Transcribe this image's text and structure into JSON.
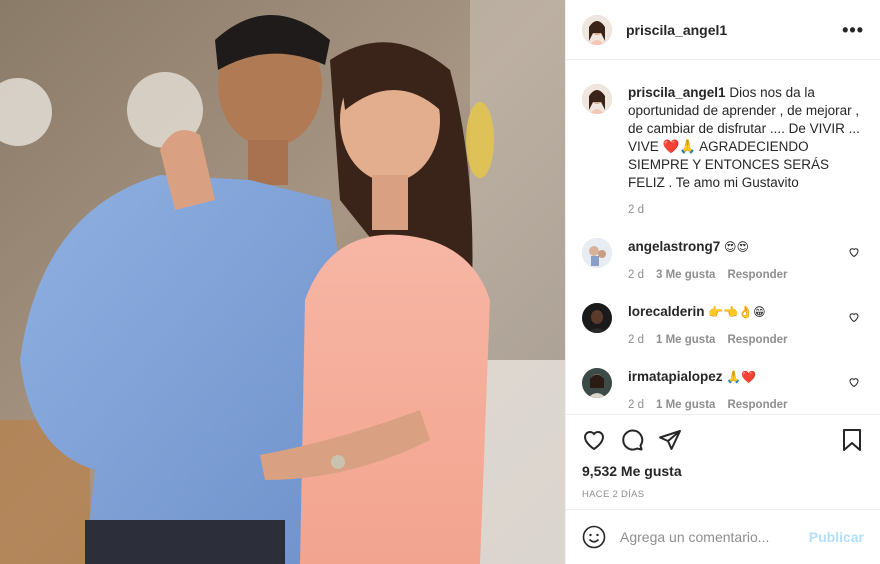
{
  "post": {
    "author": "priscila_angel1",
    "more_icon": "more-horizontal-icon",
    "caption_text": "Dios nos da la oportunidad de aprender , de mejorar , de cambiar de disfrutar .... De VIVIR ... VIVE ❤️🙏 AGRADECIENDO SIEMPRE Y ENTONCES SERÁS FELIZ . Te amo mi Gustavito",
    "caption_time": "2 d",
    "likes": "9,532 Me gusta",
    "posted_ago": "HACE 2 DÍAS"
  },
  "comments": [
    {
      "username": "angelastrong7",
      "text": "😍😍",
      "time": "2 d",
      "likes": "3 Me gusta",
      "reply": "Responder"
    },
    {
      "username": "lorecalderin",
      "text": "👉👈👌😁",
      "time": "2 d",
      "likes": "1 Me gusta",
      "reply": "Responder"
    },
    {
      "username": "irmatapialopez",
      "text": "🙏❤️",
      "time": "2 d",
      "likes": "1 Me gusta",
      "reply": "Responder"
    }
  ],
  "composer": {
    "placeholder": "Agrega un comentario...",
    "publish_label": "Publicar"
  },
  "colors": {
    "accent_disabled": "#b2dffc",
    "muted_text": "#8e8e8e",
    "divider": "#efefef"
  }
}
